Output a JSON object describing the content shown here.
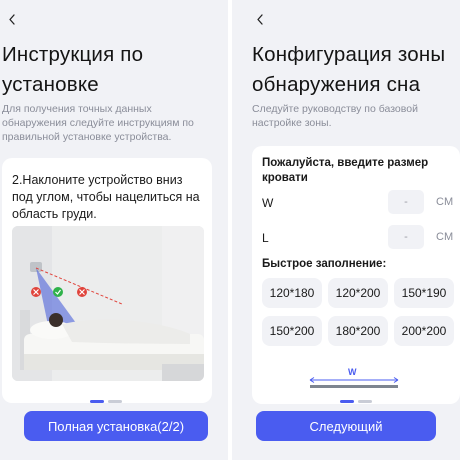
{
  "left": {
    "back_icon": "chevron-left-icon",
    "title_line1": "Инструкция по",
    "title_line2": "установке",
    "subtitle": "Для получения точных данных обнаружения следуйте инструкциям по правильной установке устройства.",
    "step_text": "2.Наклоните устройство вниз под углом, чтобы нацелиться на область груди.",
    "button_label": "Полная установка(2/2)"
  },
  "right": {
    "back_icon": "chevron-left-icon",
    "title_line1": "Конфигурация зоны",
    "title_line2": "обнаружения сна",
    "subtitle": "Следуйте руководству по базовой настройке зоны.",
    "size_prompt": "Пожалуйста, введите размер кровати",
    "width_label": "W",
    "width_value": "-",
    "width_unit": "CM",
    "length_label": "L",
    "length_value": "-",
    "length_unit": "CM",
    "quick_fill_label": "Быстрое заполнение:",
    "presets": [
      "120*180",
      "120*200",
      "150*190",
      "150*200",
      "180*200",
      "200*200"
    ],
    "diagram_label": "W",
    "button_label": "Следующий"
  },
  "colors": {
    "accent": "#4a5cf0",
    "background": "#f1f2f6",
    "card": "#ffffff",
    "muted_text": "#8a8d99",
    "ok_green": "#2fb24a",
    "error_red": "#e0443c"
  }
}
